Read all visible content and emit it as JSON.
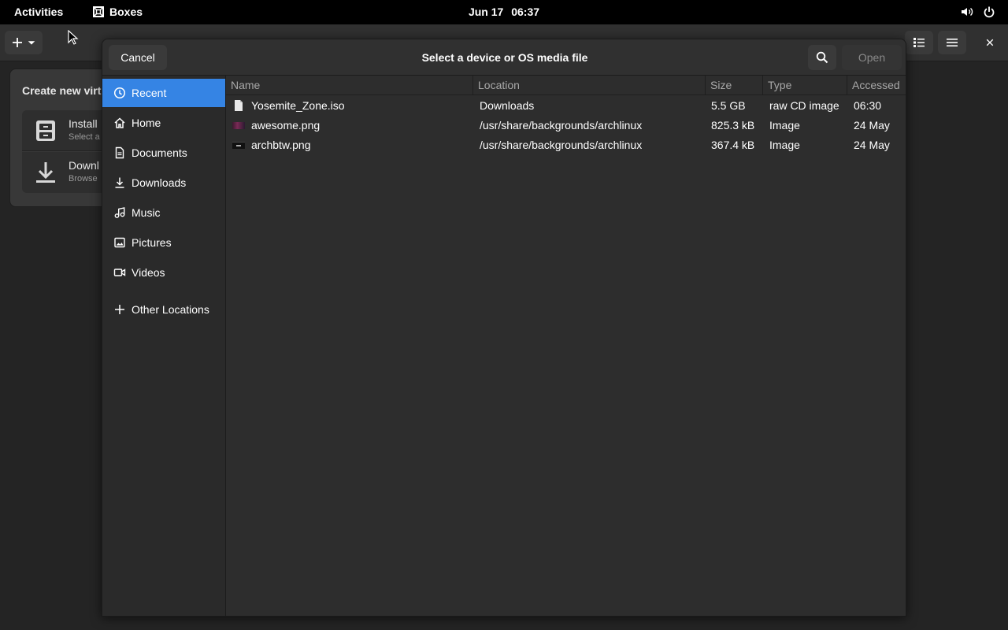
{
  "topbar": {
    "activities": "Activities",
    "app_name": "Boxes",
    "clock_date": "Jun 17",
    "clock_time": "06:37",
    "icons": [
      "volume-icon",
      "power-icon"
    ]
  },
  "boxes": {
    "popover": {
      "title": "Create new virt",
      "install_title": "Install",
      "install_sub": "Select a",
      "download_title": "Downl",
      "download_sub": "Browse"
    }
  },
  "dialog": {
    "title": "Select a device or OS media file",
    "cancel": "Cancel",
    "open": "Open",
    "places": [
      {
        "label": "Recent",
        "icon": "clock-icon",
        "selected": true
      },
      {
        "label": "Home",
        "icon": "home-icon"
      },
      {
        "label": "Documents",
        "icon": "document-icon"
      },
      {
        "label": "Downloads",
        "icon": "download-icon"
      },
      {
        "label": "Music",
        "icon": "music-icon"
      },
      {
        "label": "Pictures",
        "icon": "picture-icon"
      },
      {
        "label": "Videos",
        "icon": "video-icon"
      },
      {
        "label": "Other Locations",
        "icon": "plus-icon"
      }
    ],
    "columns": {
      "name": "Name",
      "location": "Location",
      "size": "Size",
      "type": "Type",
      "accessed": "Accessed"
    },
    "files": [
      {
        "name": "Yosemite_Zone.iso",
        "location": "Downloads",
        "size": "5.5 GB",
        "type": "raw CD image",
        "accessed": "06:30",
        "icon": "file-icon"
      },
      {
        "name": "awesome.png",
        "location": "/usr/share/backgrounds/archlinux",
        "size": "825.3 kB",
        "type": "Image",
        "accessed": "24 May",
        "icon": "image-thumbnail"
      },
      {
        "name": "archbtw.png",
        "location": "/usr/share/backgrounds/archlinux",
        "size": "367.4 kB",
        "type": "Image",
        "accessed": "24 May",
        "icon": "image-thumbnail"
      }
    ]
  },
  "colors": {
    "accent": "#3584e4",
    "topbar": "#000000",
    "window_bg": "#242424",
    "dialog_bg": "#2d2d2d"
  }
}
